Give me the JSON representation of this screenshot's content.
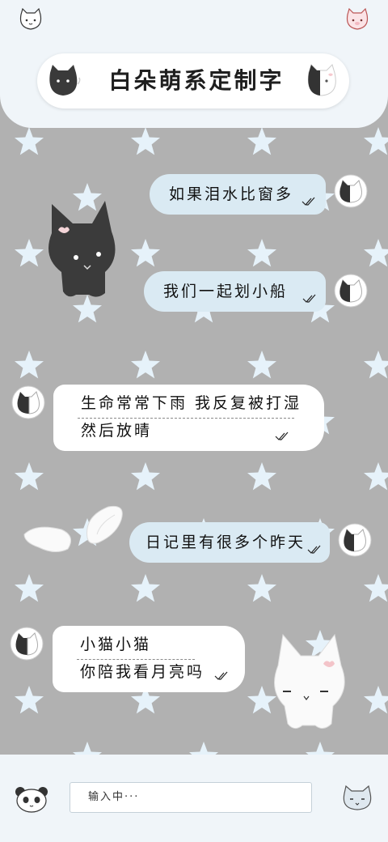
{
  "header": {
    "title": "白朵萌系定制字",
    "left_corner_icon": "cat-face-icon",
    "right_corner_icon": "pink-cat-face-icon"
  },
  "messages": [
    {
      "side": "right",
      "lines": [
        "如果泪水比窗多"
      ],
      "status_icon": "double-check-icon"
    },
    {
      "side": "right",
      "lines": [
        "我们一起划小船"
      ],
      "status_icon": "double-check-icon"
    },
    {
      "side": "left",
      "lines": [
        "生命常常下雨 我反复被打湿",
        "然后放晴"
      ],
      "status_icon": "double-check-icon"
    },
    {
      "side": "right",
      "lines": [
        "日记里有很多个昨天"
      ],
      "status_icon": "double-check-icon"
    },
    {
      "side": "left",
      "lines": [
        "小猫小猫",
        "你陪我看月亮吗"
      ],
      "status_icon": "double-check-icon"
    }
  ],
  "input": {
    "placeholder": "输入中···"
  },
  "colors": {
    "background": "#b1b1b1",
    "star": "#e6f2fa",
    "header_bg": "#f0f5f9",
    "bubble_blue": "#daeaf3",
    "bubble_white": "#ffffff"
  }
}
